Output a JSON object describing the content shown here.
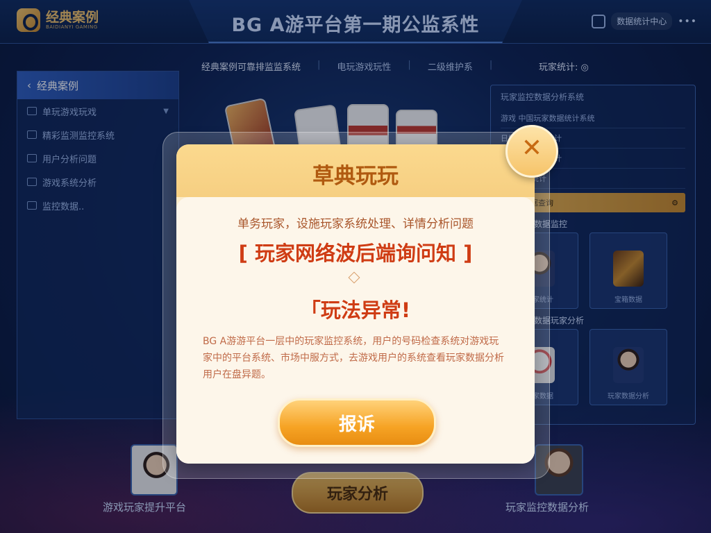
{
  "header": {
    "logo_title": "经典案例",
    "logo_subtitle": "BAIDIANYI GAMING",
    "title": "BG A游平台第一期公监系性",
    "user_label": "数据统计中心",
    "menu_glyph": "•••"
  },
  "subnav": {
    "items": [
      "经典案例可靠排监监系统",
      "电玩游戏玩性",
      "二级维护系"
    ],
    "stats": "玩家统计: ◎"
  },
  "sidebar": {
    "header": "经典案例",
    "items": [
      {
        "label": "单玩游戏玩戏"
      },
      {
        "label": "精彩监测监控系统"
      },
      {
        "label": "用户分析问题"
      },
      {
        "label": "游戏系统分析"
      },
      {
        "label": "监控数据.."
      }
    ]
  },
  "right_panel": {
    "header": "玩家监控数据分析系统",
    "rows": [
      "游戏  中国玩家数据统计系统",
      "日常玩家数据统计",
      "玩家游戏数据统计",
      "排行数据统计"
    ],
    "highlight": "玩家数据查询",
    "section1": "实时玩家数据监控",
    "cards1": [
      {
        "caption": "玩家统计"
      },
      {
        "caption": "宝箱数据"
      }
    ],
    "section2": "实时玩家数据玩家分析",
    "cards2": [
      {
        "caption": "玩家数据"
      },
      {
        "caption": "玩家数据分析"
      }
    ]
  },
  "bottom": {
    "left_caption": "游戏玩家提升平台",
    "right_caption": "玩家监控数据分析",
    "button": "玩家分析"
  },
  "modal": {
    "title": "草典玩玩",
    "description": "单务玩家，设施玩家系统处理、详情分析问题",
    "headline": "[ 玩家网络波后端询问知 ]",
    "alert": "「玩法异常!",
    "paragraph": "BG A游游平台一层中的玩家监控系统，用户的号码检查系统对游戏玩家中的平台系统、市场中服方式，去游戏用户的系统查看玩家数据分析用户在盘异题。",
    "button": "报诉",
    "close": "✕"
  },
  "colors": {
    "accent_gold": "#f3c46a",
    "modal_title": "#b05a10",
    "alert_red": "#cf3c14",
    "button_orange": "#f6a324",
    "bg_navy": "#0d2150"
  }
}
